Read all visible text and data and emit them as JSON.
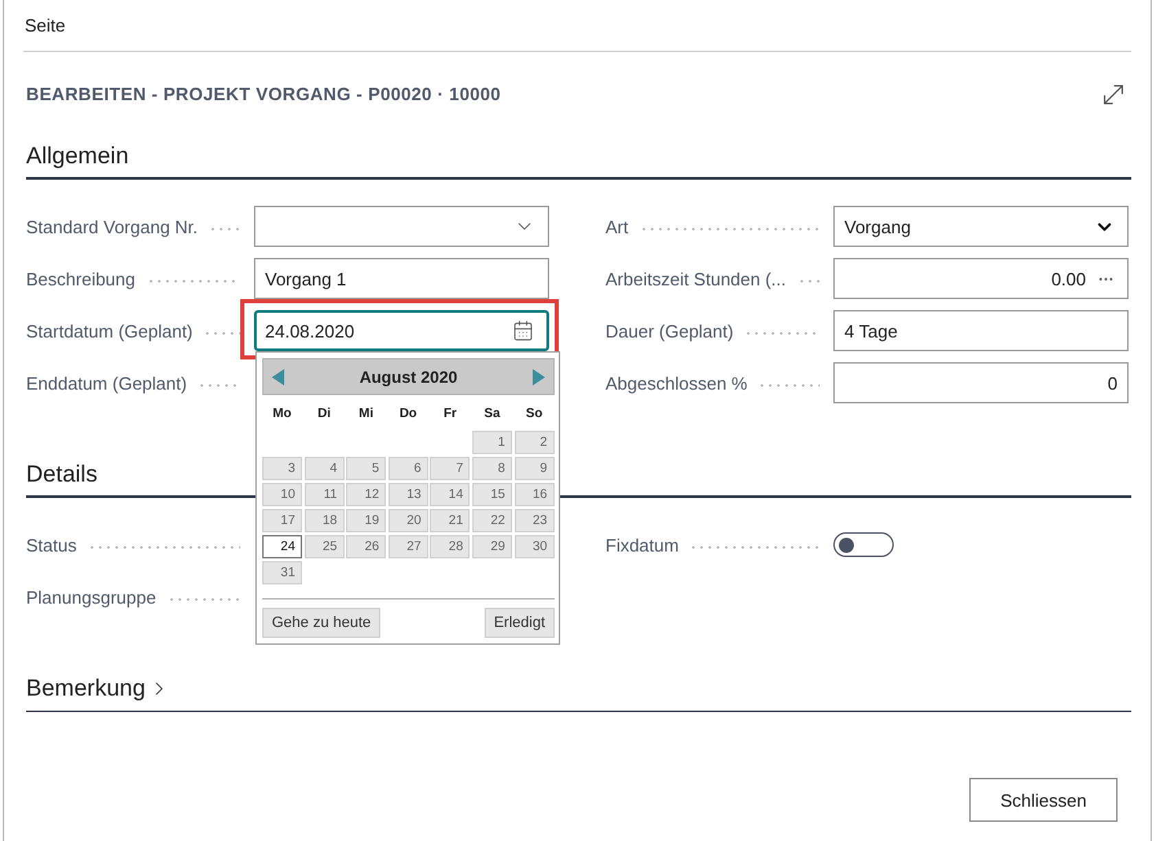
{
  "page_bar": {
    "label": "Seite"
  },
  "dialog": {
    "title": "BEARBEITEN - PROJEKT VORGANG - P00020 · 10000"
  },
  "sections": [
    {
      "title": "Allgemein",
      "expanded": true,
      "left": [
        {
          "label": "Standard Vorgang Nr.",
          "kind": "lookup"
        },
        {
          "label": "Beschreibung",
          "kind": "text",
          "value": "Vorgang 1"
        },
        {
          "label": "Startdatum (Geplant)",
          "kind": "date",
          "value": "24.08.2020",
          "focused": true,
          "highlighted": true
        },
        {
          "label": "Enddatum (Geplant)",
          "kind": "covered"
        }
      ],
      "right": [
        {
          "label": "Art",
          "kind": "select",
          "value": "Vorgang"
        },
        {
          "label": "Arbeitszeit Stunden (...",
          "kind": "number-lookup",
          "value": "0.00"
        },
        {
          "label": "Dauer (Geplant)",
          "kind": "text",
          "value": "4 Tage"
        },
        {
          "label": "Abgeschlossen %",
          "kind": "number",
          "value": "0"
        }
      ]
    },
    {
      "title": "Details",
      "expanded": true,
      "left": [
        {
          "label": "Status",
          "kind": "covered"
        },
        {
          "label": "Planungsgruppe",
          "kind": "covered"
        }
      ],
      "right": [
        {
          "label": "Fixdatum",
          "kind": "toggle",
          "on": false
        }
      ]
    },
    {
      "title": "Bemerkung",
      "expanded": false
    }
  ],
  "calendar": {
    "month": "August 2020",
    "weekdays": [
      "Mo",
      "Di",
      "Mi",
      "Do",
      "Fr",
      "Sa",
      "So"
    ],
    "weeks": [
      [
        {
          "label": "1",
          "selected": false
        },
        {
          "label": "2",
          "selected": false
        }
      ],
      [
        {
          "label": "3",
          "selected": false
        },
        {
          "label": "4",
          "selected": false
        },
        {
          "label": "5",
          "selected": false
        },
        {
          "label": "6",
          "selected": false
        },
        {
          "label": "7",
          "selected": false
        },
        {
          "label": "8",
          "selected": false
        },
        {
          "label": "9",
          "selected": false
        }
      ],
      [
        {
          "label": "10",
          "selected": false
        },
        {
          "label": "11",
          "selected": false
        },
        {
          "label": "12",
          "selected": false
        },
        {
          "label": "13",
          "selected": false
        },
        {
          "label": "14",
          "selected": false
        },
        {
          "label": "15",
          "selected": false
        },
        {
          "label": "16",
          "selected": false
        }
      ],
      [
        {
          "label": "17",
          "selected": false
        },
        {
          "label": "18",
          "selected": false
        },
        {
          "label": "19",
          "selected": false
        },
        {
          "label": "20",
          "selected": false
        },
        {
          "label": "21",
          "selected": false
        },
        {
          "label": "22",
          "selected": false
        },
        {
          "label": "23",
          "selected": false
        }
      ],
      [
        {
          "label": "24",
          "selected": true
        },
        {
          "label": "25",
          "selected": false
        },
        {
          "label": "26",
          "selected": false
        },
        {
          "label": "27",
          "selected": false
        },
        {
          "label": "28",
          "selected": false
        },
        {
          "label": "29",
          "selected": false
        },
        {
          "label": "30",
          "selected": false
        }
      ],
      [
        {
          "label": "31",
          "selected": false
        }
      ]
    ],
    "today_button": "Gehe zu heute",
    "done_button": "Erledigt"
  },
  "footer": {
    "close_button": "Schliessen"
  }
}
